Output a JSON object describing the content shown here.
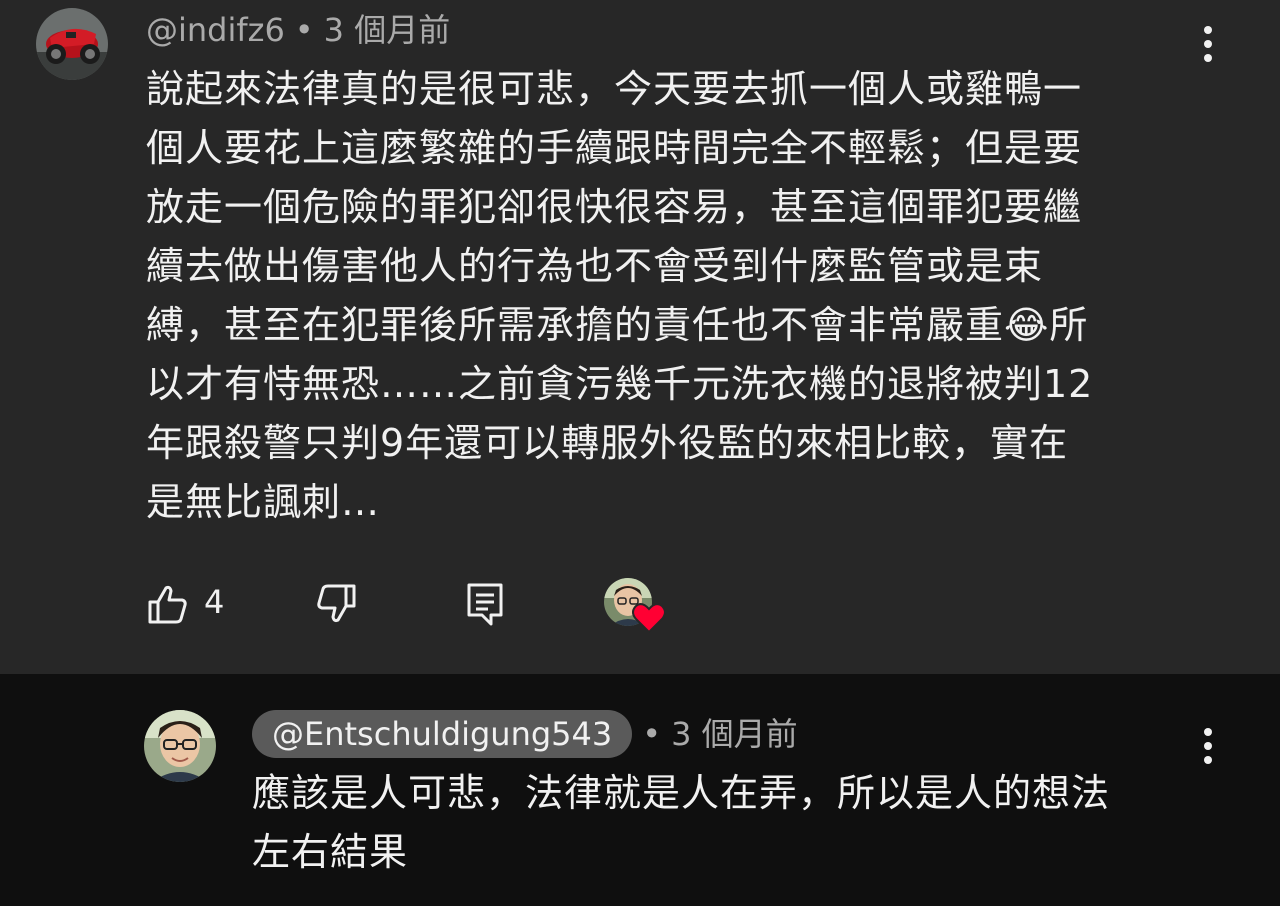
{
  "comment": {
    "handle": "@indifz6",
    "time": "3 個月前",
    "lines": [
      "說起來法律真的是很可悲，今天要去抓一個人或雞鴨一",
      "個人要花上這麼繁雜的手續跟時間完全不輕鬆；但是要",
      "放走一個危險的罪犯卻很快很容易，甚至這個罪犯要繼",
      "續去做出傷害他人的行為也不會受到什麼監管或是束",
      "縛，甚至在犯罪後所需承擔的責任也不會非常嚴重😂所",
      "以才有恃無恐……之前貪污幾千元洗衣機的退將被判12",
      "年跟殺警只判9年還可以轉服外役監的來相比較，實在",
      "是無比諷刺…"
    ],
    "like_count": "4",
    "icons": {
      "avatar": "motorcycle-avatar",
      "like": "thumb-up-icon",
      "dislike": "thumb-down-icon",
      "reply": "reply-icon",
      "heart": "heart-icon",
      "menu": "more-vert-icon"
    }
  },
  "reply": {
    "handle": "@Entschuldigung543",
    "time": "3 個月前",
    "lines": [
      "應該是人可悲，法律就是人在弄，所以是人的想法",
      "左右結果"
    ]
  },
  "separator": "•",
  "colors": {
    "background": "#0f0f0f",
    "highlight_background": "#272727",
    "text": "#f1f1f1",
    "meta_text": "#aaaaaa",
    "heart": "#ff0033",
    "handle_pill": "#5a5a5a"
  }
}
